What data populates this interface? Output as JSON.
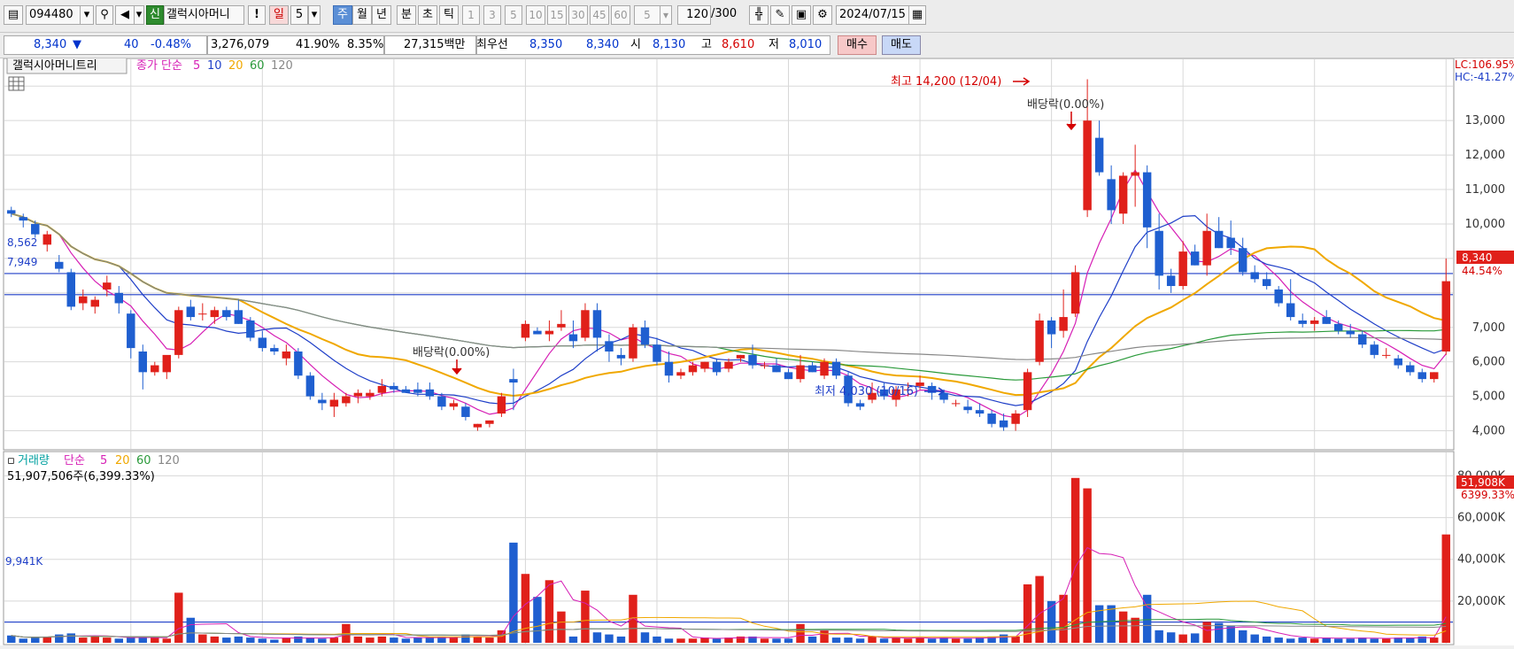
{
  "toolbar": {
    "code": "094480",
    "shin": "신",
    "name": "갤럭시아머니",
    "warn": "!",
    "day": "일",
    "day_n": "5",
    "periods": [
      "주",
      "월",
      "년",
      "분",
      "초",
      "틱"
    ],
    "minutes": [
      "1",
      "3",
      "5",
      "10",
      "15",
      "30",
      "45",
      "60"
    ],
    "tick_n": "5",
    "count": "120",
    "count_total": "/300",
    "date": "2024/07/15"
  },
  "info": {
    "price": "8,340",
    "arrow": "▼",
    "change": "40",
    "pct": "-0.48%",
    "volume": "3,276,079",
    "vol_ratio": "41.90%",
    "turnover": "8.35%",
    "amount": "27,315백만",
    "best_label": "최우선",
    "ask": "8,350",
    "bid": "8,340",
    "open_label": "시",
    "open": "8,130",
    "high_label": "고",
    "high": "8,610",
    "low_label": "저",
    "low": "8,010",
    "buy": "매수",
    "sell": "매도"
  },
  "price_panel": {
    "legend_name": "갤럭시아머니트리",
    "legend_ma": "종가 단순",
    "ma_periods": [
      "5",
      "10",
      "20",
      "60",
      "120"
    ],
    "ma_colors": [
      "#d61fb5",
      "#1f3fc8",
      "#f0a800",
      "#2a9a3a",
      "#888888"
    ],
    "lc": "LC:106.95%",
    "hc": "HC:-41.27%",
    "current_price": "8,340",
    "current_pct": "44.54%",
    "hline1": "8,562",
    "hline2": "7,949",
    "high_ann": "최고 14,200 (12/04)",
    "low_ann": "최저 4,030 (10/16)",
    "div1": "배당락(0.00%)",
    "div2": "배당락(0.00%)",
    "y_ticks": [
      "13,000",
      "12,000",
      "11,000",
      "10,000",
      "9,000",
      "7,000",
      "6,000",
      "5,000",
      "4,000"
    ]
  },
  "volume_panel": {
    "legend_name": "거래량",
    "legend_ma": "단순",
    "ma_periods": [
      "5",
      "20",
      "60",
      "120"
    ],
    "summary": "51,907,506주(6,399.33%)",
    "hline": "9,941K",
    "current": "51,908K",
    "current_pct": "6399.33%",
    "y_ticks": [
      "80,000K",
      "60,000K",
      "40,000K",
      "20,000K"
    ]
  },
  "colors": {
    "up": "#e0201a",
    "down": "#1f5fd0",
    "grid": "#d8d8d8"
  },
  "chart_data": {
    "type": "candlestick",
    "price_ylim": [
      3500,
      14700
    ],
    "volume_ylim": [
      0,
      84000
    ],
    "candles": [
      [
        10400,
        10500,
        10200,
        10300,
        3500
      ],
      [
        10200,
        10300,
        9900,
        10100,
        2000
      ],
      [
        10000,
        10100,
        9600,
        9700,
        2500
      ],
      [
        9400,
        9800,
        9200,
        9700,
        3000
      ],
      [
        8900,
        9100,
        8600,
        8700,
        4000
      ],
      [
        8600,
        8700,
        7500,
        7600,
        4500
      ],
      [
        7700,
        8100,
        7500,
        7900,
        2500
      ],
      [
        7600,
        7900,
        7400,
        7800,
        3000
      ],
      [
        8100,
        8500,
        7900,
        8300,
        2500
      ],
      [
        8000,
        8200,
        7400,
        7700,
        2000
      ],
      [
        7400,
        7500,
        6100,
        6400,
        2500
      ],
      [
        6300,
        6500,
        5200,
        5700,
        3000
      ],
      [
        5700,
        6000,
        5600,
        5900,
        2500
      ],
      [
        5700,
        6100,
        5500,
        6200,
        2000
      ],
      [
        6200,
        7600,
        6100,
        7500,
        24000
      ],
      [
        7600,
        7800,
        7200,
        7300,
        12000
      ],
      [
        7400,
        7700,
        7200,
        7400,
        4000
      ],
      [
        7300,
        7600,
        7100,
        7500,
        3000
      ],
      [
        7500,
        7600,
        7200,
        7300,
        2500
      ],
      [
        7500,
        7800,
        7100,
        7100,
        3000
      ],
      [
        7200,
        7300,
        6600,
        6700,
        2500
      ],
      [
        6700,
        6900,
        6300,
        6400,
        2000
      ],
      [
        6400,
        6500,
        6200,
        6300,
        1500
      ],
      [
        6100,
        6500,
        5900,
        6300,
        2500
      ],
      [
        6300,
        6400,
        5500,
        5600,
        3000
      ],
      [
        5600,
        5700,
        4900,
        5000,
        2500
      ],
      [
        4900,
        5100,
        4600,
        4800,
        2000
      ],
      [
        4700,
        5100,
        4400,
        4900,
        2500
      ],
      [
        4800,
        5100,
        4700,
        5000,
        9000
      ],
      [
        5000,
        5200,
        4800,
        5100,
        3000
      ],
      [
        5000,
        5200,
        4900,
        5100,
        2500
      ],
      [
        5100,
        5500,
        5000,
        5300,
        3000
      ],
      [
        5300,
        5400,
        5100,
        5200,
        2500
      ],
      [
        5200,
        5300,
        5100,
        5100,
        2000
      ],
      [
        5200,
        5400,
        5000,
        5100,
        2500
      ],
      [
        5200,
        5400,
        4900,
        5000,
        2500
      ],
      [
        5000,
        5100,
        4600,
        4700,
        3000
      ],
      [
        4700,
        4900,
        4600,
        4800,
        2500
      ],
      [
        4700,
        4800,
        4300,
        4400,
        4000
      ],
      [
        4100,
        4200,
        4000,
        4200,
        3000
      ],
      [
        4200,
        4300,
        4100,
        4300,
        2500
      ],
      [
        4500,
        5100,
        4400,
        5000,
        6000
      ],
      [
        5500,
        5800,
        4600,
        5400,
        48000
      ],
      [
        6700,
        7200,
        6600,
        7100,
        33000
      ],
      [
        6900,
        7000,
        6800,
        6800,
        22000
      ],
      [
        6800,
        7200,
        6600,
        6900,
        30000
      ],
      [
        7000,
        7500,
        6900,
        7100,
        15000
      ],
      [
        6800,
        7200,
        6400,
        6600,
        3000
      ],
      [
        6700,
        7700,
        6600,
        7500,
        25000
      ],
      [
        7500,
        7700,
        6300,
        6700,
        5000
      ],
      [
        6600,
        6800,
        6000,
        6300,
        4000
      ],
      [
        6200,
        6400,
        5900,
        6100,
        3000
      ],
      [
        6100,
        7100,
        6000,
        7000,
        23000
      ],
      [
        7000,
        7200,
        6400,
        6500,
        5000
      ],
      [
        6500,
        6700,
        5900,
        6000,
        3000
      ],
      [
        6000,
        6300,
        5400,
        5600,
        2000
      ],
      [
        5600,
        5800,
        5500,
        5700,
        2000
      ],
      [
        5700,
        6000,
        5600,
        5900,
        2000
      ],
      [
        5800,
        6000,
        5700,
        6000,
        2500
      ],
      [
        6000,
        6100,
        5600,
        5700,
        2000
      ],
      [
        5800,
        6100,
        5700,
        6000,
        2500
      ],
      [
        6100,
        6200,
        6000,
        6200,
        3000
      ],
      [
        6200,
        6500,
        5800,
        5900,
        3000
      ],
      [
        5900,
        6000,
        5800,
        5900,
        2000
      ],
      [
        5900,
        6100,
        5700,
        5700,
        2000
      ],
      [
        5700,
        5800,
        5500,
        5500,
        2000
      ],
      [
        5500,
        6200,
        5400,
        5900,
        9000
      ],
      [
        5900,
        6000,
        5700,
        5700,
        3000
      ],
      [
        5600,
        6100,
        5500,
        6000,
        6000
      ],
      [
        6000,
        6100,
        5500,
        5600,
        2500
      ],
      [
        5600,
        5700,
        4700,
        4800,
        2500
      ],
      [
        4800,
        4900,
        4600,
        4700,
        2000
      ],
      [
        4900,
        5400,
        4800,
        5100,
        3000
      ],
      [
        5200,
        5400,
        4900,
        5000,
        2000
      ],
      [
        4900,
        5300,
        4700,
        5200,
        2500
      ],
      [
        5200,
        5400,
        5000,
        5200,
        2000
      ],
      [
        5300,
        5600,
        5200,
        5400,
        2500
      ],
      [
        5300,
        5400,
        4900,
        5100,
        2000
      ],
      [
        5100,
        5200,
        4800,
        4900,
        2500
      ],
      [
        4800,
        4900,
        4700,
        4800,
        2000
      ],
      [
        4700,
        4900,
        4500,
        4600,
        2000
      ],
      [
        4600,
        4800,
        4400,
        4500,
        2500
      ],
      [
        4500,
        4600,
        4100,
        4200,
        3000
      ],
      [
        4300,
        4500,
        4000,
        4100,
        4000
      ],
      [
        4200,
        4600,
        4000,
        4500,
        3000
      ],
      [
        4600,
        5800,
        4400,
        5700,
        28000
      ],
      [
        6000,
        7400,
        5900,
        7200,
        32000
      ],
      [
        7200,
        7300,
        6400,
        6800,
        20000
      ],
      [
        6900,
        8100,
        6700,
        7300,
        23000
      ],
      [
        7400,
        8800,
        7300,
        8600,
        79000
      ],
      [
        10400,
        14200,
        10200,
        13000,
        74000
      ],
      [
        12500,
        13000,
        11400,
        11500,
        18000
      ],
      [
        11300,
        11700,
        10000,
        10400,
        18000
      ],
      [
        10300,
        11500,
        10000,
        11400,
        15000
      ],
      [
        11400,
        12300,
        10500,
        11500,
        12000
      ],
      [
        11500,
        11700,
        9300,
        9900,
        23000
      ],
      [
        9800,
        10300,
        8100,
        8500,
        6000
      ],
      [
        8500,
        8700,
        8000,
        8200,
        5000
      ],
      [
        8200,
        9500,
        8100,
        9200,
        4000
      ],
      [
        9200,
        9400,
        8800,
        8800,
        4500
      ],
      [
        8800,
        10300,
        8500,
        9800,
        10000
      ],
      [
        9800,
        10200,
        9300,
        9300,
        9500
      ],
      [
        9600,
        10100,
        9100,
        9300,
        8000
      ],
      [
        9300,
        9600,
        8500,
        8600,
        6000
      ],
      [
        8600,
        8800,
        8300,
        8400,
        4000
      ],
      [
        8400,
        8600,
        8100,
        8200,
        3000
      ],
      [
        8100,
        8200,
        7600,
        7700,
        2500
      ],
      [
        7700,
        8400,
        7200,
        7300,
        2000
      ],
      [
        7200,
        7400,
        7000,
        7100,
        2500
      ],
      [
        7100,
        7300,
        6900,
        7200,
        2000
      ],
      [
        7300,
        7500,
        7100,
        7100,
        2500
      ],
      [
        7100,
        7200,
        6800,
        6900,
        2000
      ],
      [
        6900,
        7100,
        6700,
        6800,
        2000
      ],
      [
        6800,
        6900,
        6400,
        6500,
        2500
      ],
      [
        6500,
        6600,
        6100,
        6200,
        2000
      ],
      [
        6200,
        6400,
        6100,
        6200,
        2000
      ],
      [
        6100,
        6200,
        5800,
        5900,
        2500
      ],
      [
        5900,
        6000,
        5600,
        5700,
        2500
      ],
      [
        5700,
        5800,
        5400,
        5500,
        3000
      ],
      [
        5500,
        5700,
        5400,
        5700,
        2500
      ],
      [
        6300,
        9000,
        6200,
        8340,
        51908
      ]
    ],
    "series": [
      {
        "name": "5",
        "color": "#d61fb5"
      },
      {
        "name": "10",
        "color": "#1f3fc8"
      },
      {
        "name": "20",
        "color": "#f0a800"
      },
      {
        "name": "60",
        "color": "#2a9a3a"
      },
      {
        "name": "120",
        "color": "#888888"
      }
    ]
  }
}
